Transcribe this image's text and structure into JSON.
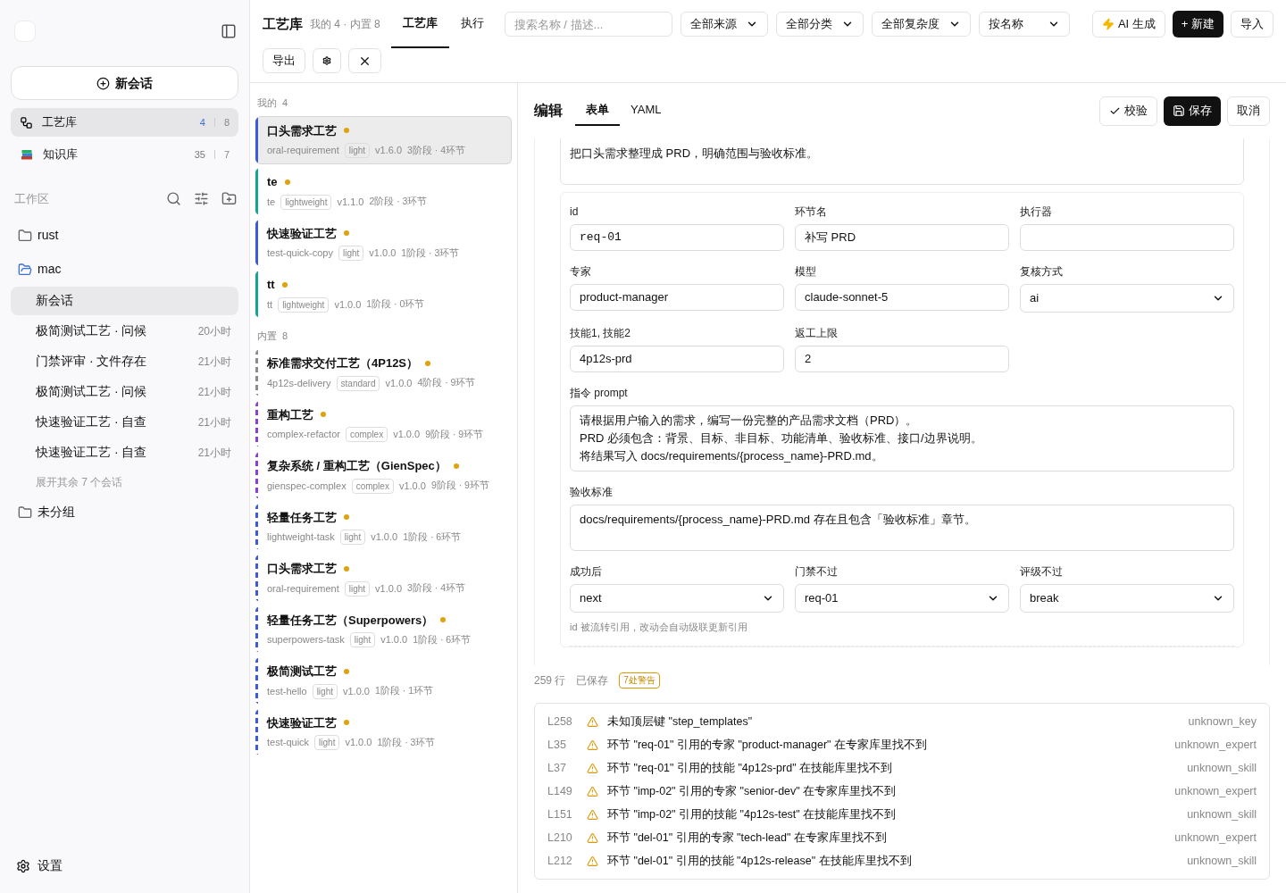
{
  "sidebar": {
    "new_session": "新会话",
    "nav": [
      {
        "kind": "workflow",
        "label": "工艺库",
        "counts": [
          "4",
          "8"
        ],
        "selected": true
      },
      {
        "kind": "books",
        "label": "知识库",
        "counts": [
          "35",
          "7"
        ],
        "selected": false
      }
    ],
    "workspace_title": "工作区",
    "folders": [
      {
        "name": "rust",
        "expanded": false
      },
      {
        "name": "mac",
        "expanded": true,
        "children": [
          {
            "title": "新会话",
            "selected": true
          },
          {
            "title": "极简测试工艺 · 问候",
            "time": "20小时",
            "selected": false
          },
          {
            "title": "门禁评审 · 文件存在",
            "time": "21小时",
            "selected": false
          },
          {
            "title": "极简测试工艺 · 问候",
            "time": "21小时",
            "selected": false
          },
          {
            "title": "快速验证工艺 · 自查",
            "time": "21小时",
            "selected": false
          },
          {
            "title": "快速验证工艺 · 自查",
            "time": "21小时",
            "selected": false
          }
        ],
        "more": "展开其余 7 个会话"
      },
      {
        "name": "未分组",
        "expanded": false
      }
    ],
    "settings": "设置"
  },
  "header": {
    "title": "工艺库",
    "subtitle": "我的 4 · 内置 8",
    "tabs": [
      {
        "label": "工艺库",
        "selected": true
      },
      {
        "label": "执行",
        "selected": false
      }
    ],
    "search": {
      "placeholder": "搜索名称 / 描述..."
    },
    "filters": [
      "全部来源",
      "全部分类",
      "全部复杂度",
      "按名称"
    ],
    "buttons": [
      {
        "kind": "ai",
        "label": "AI 生成"
      },
      {
        "kind": "primary",
        "label": "+ 新建"
      },
      {
        "kind": "plain",
        "label": "导入"
      }
    ],
    "row2": [
      {
        "kind": "text",
        "label": "导出"
      },
      {
        "kind": "gear"
      },
      {
        "kind": "close"
      }
    ]
  },
  "groups": [
    {
      "label": "我的",
      "count": "4",
      "dashed": false,
      "items": [
        {
          "title": "口头需求工艺",
          "slug": "oral-requirement",
          "tag": "light",
          "version": "v1.6.0",
          "stats": "3阶段 · 4环节",
          "color": "#3b5bdb",
          "selected": true
        },
        {
          "title": "te",
          "slug": "te",
          "tag": "lightweight",
          "version": "v1.1.0",
          "stats": "2阶段 · 3环节",
          "color": "#12a594",
          "selected": false
        },
        {
          "title": "快速验证工艺",
          "slug": "test-quick-copy",
          "tag": "light",
          "version": "v1.0.0",
          "stats": "1阶段 · 3环节",
          "color": "#3b5bdb",
          "selected": false
        },
        {
          "title": "tt",
          "slug": "tt",
          "tag": "lightweight",
          "version": "v1.0.0",
          "stats": "1阶段 · 0环节",
          "color": "#12a594",
          "selected": false
        }
      ]
    },
    {
      "label": "内置",
      "count": "8",
      "dashed": true,
      "items": [
        {
          "title": "标准需求交付工艺（4P12S）",
          "slug": "4p12s-delivery",
          "tag": "standard",
          "version": "v1.0.0",
          "stats": "4阶段 · 9环节",
          "color": "#8c8c8c",
          "selected": false
        },
        {
          "title": "重构工艺",
          "slug": "complex-refactor",
          "tag": "complex",
          "version": "v1.0.0",
          "stats": "9阶段 · 9环节",
          "color": "#8b3fd9",
          "selected": false
        },
        {
          "title": "复杂系统 / 重构工艺（GienSpec）",
          "slug": "gienspec-complex",
          "tag": "complex",
          "version": "v1.0.0",
          "stats": "9阶段 · 9环节",
          "color": "#8b3fd9",
          "selected": false
        },
        {
          "title": "轻量任务工艺",
          "slug": "lightweight-task",
          "tag": "light",
          "version": "v1.0.0",
          "stats": "1阶段 · 6环节",
          "color": "#3b5bdb",
          "selected": false
        },
        {
          "title": "口头需求工艺",
          "slug": "oral-requirement",
          "tag": "light",
          "version": "v1.0.0",
          "stats": "3阶段 · 4环节",
          "color": "#3b5bdb",
          "selected": false
        },
        {
          "title": "轻量任务工艺（Superpowers）",
          "slug": "superpowers-task",
          "tag": "light",
          "version": "v1.0.0",
          "stats": "1阶段 · 6环节",
          "color": "#3b5bdb",
          "selected": false
        },
        {
          "title": "极简测试工艺",
          "slug": "test-hello",
          "tag": "light",
          "version": "v1.0.0",
          "stats": "1阶段 · 1环节",
          "color": "#3b5bdb",
          "selected": false
        },
        {
          "title": "快速验证工艺",
          "slug": "test-quick",
          "tag": "light",
          "version": "v1.0.0",
          "stats": "1阶段 · 3环节",
          "color": "#3b5bdb",
          "selected": false
        }
      ]
    }
  ],
  "editor": {
    "title": "编辑",
    "tabs": [
      {
        "label": "表单",
        "selected": true
      },
      {
        "label": "YAML",
        "selected": false
      }
    ],
    "actions": [
      {
        "kind": "check",
        "label": "校验"
      },
      {
        "kind": "save",
        "label": "保存"
      },
      {
        "kind": "plain",
        "label": "取消"
      }
    ],
    "description": "把口头需求整理成 PRD，明确范围与验收标准。",
    "rows": [
      [
        {
          "kind": "mono",
          "label": "id",
          "value": "req-01"
        },
        {
          "kind": "input",
          "label": "环节名",
          "value": "补写 PRD"
        },
        {
          "kind": "input",
          "label": "执行器"
        }
      ],
      [
        {
          "kind": "input",
          "label": "专家",
          "value": "product-manager"
        },
        {
          "kind": "input",
          "label": "模型",
          "value": "claude-sonnet-5"
        },
        {
          "kind": "select",
          "label": "复核方式",
          "value": "ai"
        }
      ],
      [
        {
          "kind": "input",
          "label": "技能1, 技能2",
          "value": "4p12s-prd"
        },
        {
          "kind": "input",
          "label": "返工上限",
          "value": "2"
        }
      ],
      [
        {
          "kind": "textarea",
          "label": "指令 prompt",
          "lines": [
            "请根据用户输入的需求，编写一份完整的产品需求文档（PRD）。",
            "PRD 必须包含：背景、目标、非目标、功能清单、验收标准、接口/边界说明。",
            "将结果写入 docs/requirements/{process_name}-PRD.md。"
          ]
        }
      ],
      [
        {
          "kind": "textarea",
          "label": "验收标准",
          "lines": [
            "docs/requirements/{process_name}-PRD.md 存在且包含「验收标准」章节。"
          ]
        }
      ],
      [
        {
          "kind": "select",
          "label": "成功后",
          "value": "next"
        },
        {
          "kind": "select",
          "label": "门禁不过",
          "value": "req-01"
        },
        {
          "kind": "select",
          "label": "评级不过",
          "value": "break"
        }
      ]
    ],
    "note": "id 被流转引用，改动会自动级联更新引用",
    "status": {
      "lines": "259 行",
      "saved": "已保存",
      "warnings": "7处警告"
    },
    "warnings": [
      {
        "line": "L258",
        "message": "未知顶层键 \"step_templates\"",
        "code": "unknown_key"
      },
      {
        "line": "L35",
        "message": "环节 \"req-01\" 引用的专家 \"product-manager\" 在专家库里找不到",
        "code": "unknown_expert"
      },
      {
        "line": "L37",
        "message": "环节 \"req-01\" 引用的技能 \"4p12s-prd\" 在技能库里找不到",
        "code": "unknown_skill"
      },
      {
        "line": "L149",
        "message": "环节 \"imp-02\" 引用的专家 \"senior-dev\" 在专家库里找不到",
        "code": "unknown_expert"
      },
      {
        "line": "L151",
        "message": "环节 \"imp-02\" 引用的技能 \"4p12s-test\" 在技能库里找不到",
        "code": "unknown_skill"
      },
      {
        "line": "L210",
        "message": "环节 \"del-01\" 引用的专家 \"tech-lead\" 在专家库里找不到",
        "code": "unknown_expert"
      },
      {
        "line": "L212",
        "message": "环节 \"del-01\" 引用的技能 \"4p12s-release\" 在技能库里找不到",
        "code": "unknown_skill"
      }
    ]
  }
}
